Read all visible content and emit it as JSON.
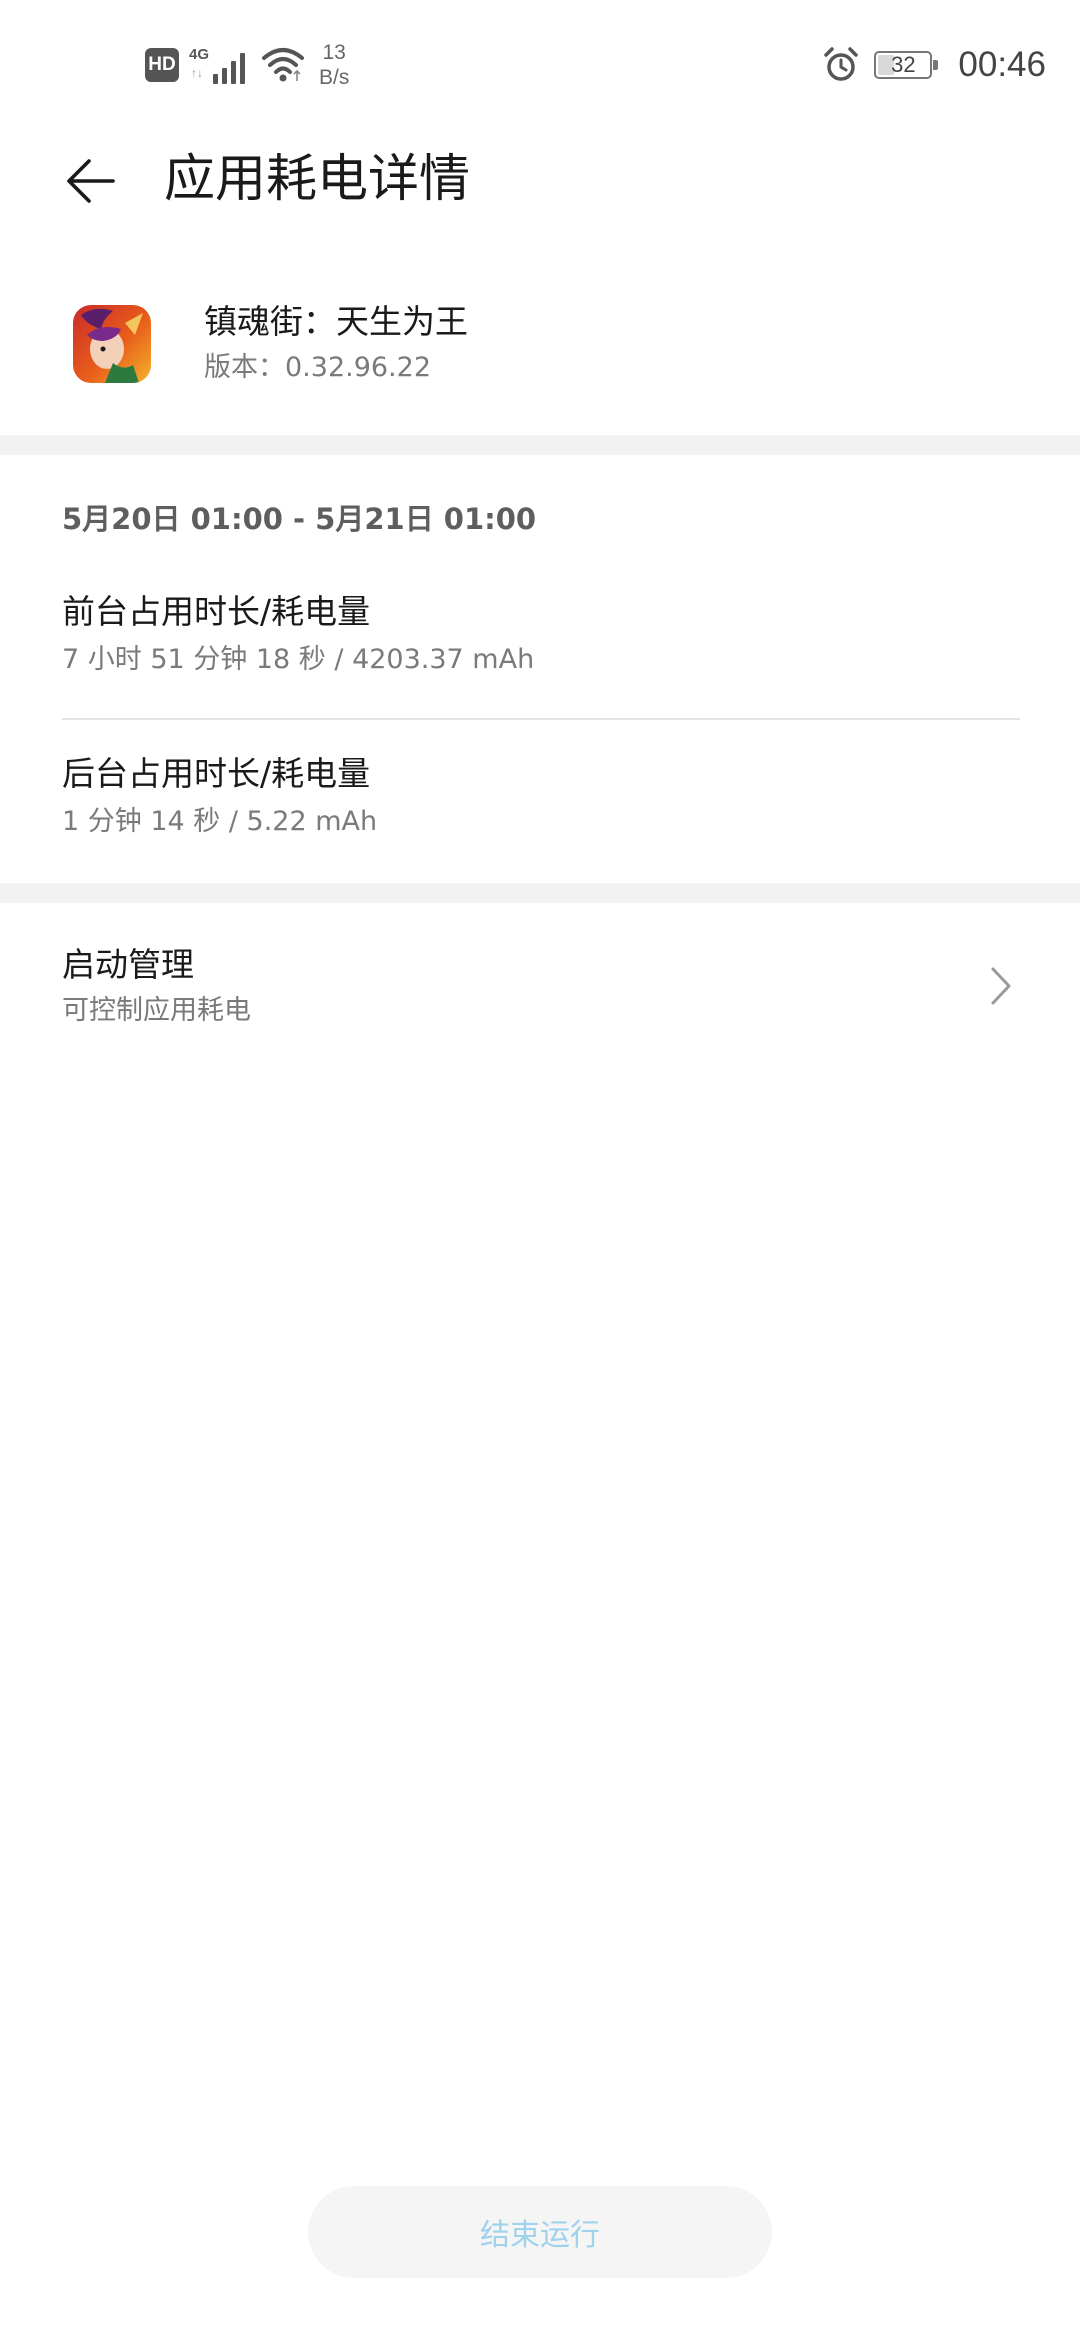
{
  "status_bar": {
    "hd_badge": "HD",
    "network_type": "4G",
    "network_arrows": "↑↓",
    "net_speed_value": "13",
    "net_speed_unit": "B/s",
    "battery_level": "32",
    "battery_fraction": 0.32,
    "time": "00:46",
    "icons": [
      "hd-icon",
      "signal-4g-icon",
      "wifi-icon",
      "alarm-icon",
      "battery-icon"
    ]
  },
  "header": {
    "back_icon": "arrow-left-icon",
    "title": "应用耗电详情"
  },
  "app": {
    "name": "镇魂街：天生为王",
    "version": "版本：0.32.96.22"
  },
  "usage": {
    "date_range": "5月20日 01:00 - 5月21日 01:00",
    "foreground": {
      "title": "前台占用时长/耗电量",
      "value": "7 小时 51 分钟 18 秒 / 4203.37 mAh"
    },
    "background": {
      "title": "后台占用时长/耗电量",
      "value": "1 分钟 14 秒 / 5.22 mAh"
    }
  },
  "startup_management": {
    "title": "启动管理",
    "subtitle": "可控制应用耗电",
    "chevron_icon": "chevron-right-icon"
  },
  "end_button": {
    "label": "结束运行"
  },
  "colors": {
    "divider_band": "#f2f2f2",
    "secondary_text": "#7a7a7a",
    "end_button_text": "#9fd2ec",
    "end_button_bg": "#f5f5f5"
  }
}
